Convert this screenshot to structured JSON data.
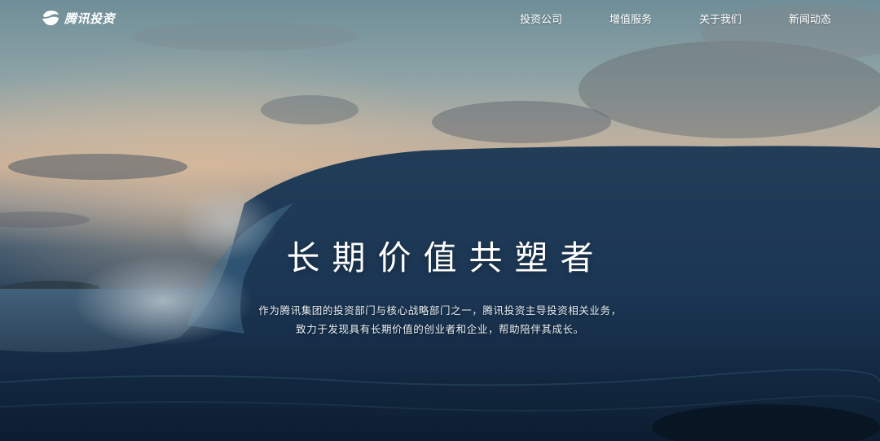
{
  "brand": {
    "logo_text": "腾讯投资",
    "logo_icon": "tencent-wave-logo-icon"
  },
  "nav": {
    "items": [
      {
        "label": "投资公司"
      },
      {
        "label": "增值服务"
      },
      {
        "label": "关于我们"
      },
      {
        "label": "新闻动态"
      }
    ]
  },
  "hero": {
    "title": "长期价值共塑者",
    "description": [
      "作为腾讯集团的投资部门与核心战略部门之一，腾讯投资主导投资相关业务，",
      "致力于发现具有长期价值的创业者和企业，帮助陪伴其成长。"
    ],
    "background": "ocean-wave-image",
    "colors": {
      "text": "#ffffff",
      "sky_top": "#6f8e98",
      "sky_glow": "#c7ae96",
      "sea_deep": "#0a1a2c"
    }
  }
}
